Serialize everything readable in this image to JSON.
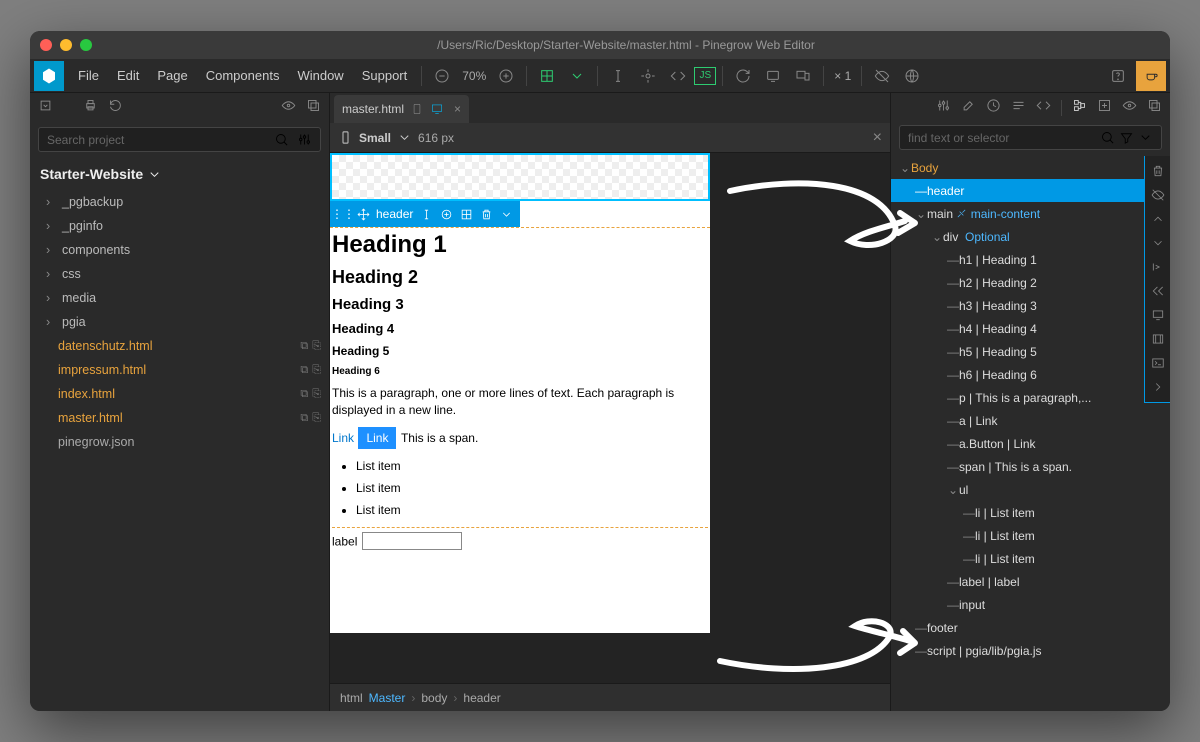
{
  "window_title": "/Users/Ric/Desktop/Starter-Website/master.html - Pinegrow Web Editor",
  "menu": [
    "File",
    "Edit",
    "Page",
    "Components",
    "Window",
    "Support"
  ],
  "zoom": "70%",
  "multiplier": "× 1",
  "search_placeholder": "Search project",
  "project_name": "Starter-Website",
  "folders": [
    "_pgbackup",
    "_pginfo",
    "components",
    "css",
    "media",
    "pgia"
  ],
  "files": [
    "datenschutz.html",
    "impressum.html",
    "index.html",
    "master.html"
  ],
  "plain_files": [
    "pinegrow.json"
  ],
  "tab_label": "master.html",
  "viewport_size_label": "Small",
  "viewport_px": "616 px",
  "selected_element": "header",
  "page_content": {
    "h1": "Heading 1",
    "h2": "Heading 2",
    "h3": "Heading 3",
    "h4": "Heading 4",
    "h5": "Heading 5",
    "h6": "Heading 6",
    "p": "This is a paragraph, one or more lines of text. Each paragraph is displayed in a new line.",
    "link1": "Link",
    "link2": "Link",
    "span": "This is a span.",
    "li": "List item",
    "label": "label"
  },
  "breadcrumb": {
    "root": "html",
    "master": "Master",
    "body": "body",
    "sel": "header"
  },
  "right_search_placeholder": "find text or selector",
  "dom": {
    "body": "Body",
    "header": "header",
    "main": "main",
    "main_class": "main-content",
    "div": "div",
    "div_class": "Optional",
    "h1": "h1 | Heading 1",
    "h2": "h2 | Heading 2",
    "h3": "h3 | Heading 3",
    "h4": "h4 | Heading 4",
    "h5": "h5 | Heading 5",
    "h6": "h6 | Heading 6",
    "p": "p | This is a paragraph,...",
    "a": "a | Link",
    "abtn": "a.Button | Link",
    "span": "span | This is a span.",
    "ul": "ul",
    "li": "li | List item",
    "label": "label | label",
    "input": "input",
    "footer": "footer",
    "script": "script | pgia/lib/pgia.js"
  }
}
